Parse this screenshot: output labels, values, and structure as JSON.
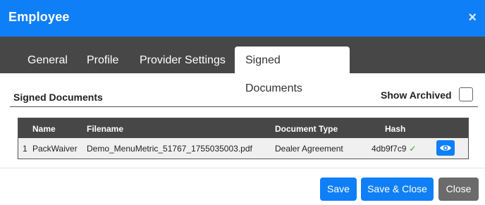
{
  "dialog": {
    "title": "Employee",
    "close_glyph": "×"
  },
  "tabs": [
    {
      "label": "General"
    },
    {
      "label": "Profile"
    },
    {
      "label": "Provider Settings"
    },
    {
      "label": "Signed Documents",
      "active": true
    }
  ],
  "section": {
    "title": "Signed Documents",
    "show_archived_label": "Show Archived",
    "show_archived_checked": false
  },
  "table": {
    "columns": [
      "Name",
      "Filename",
      "Document Type",
      "Hash"
    ],
    "rows": [
      {
        "index": "1",
        "name": "PackWaiver",
        "filename": "Demo_MenuMetric_51767_1755035003.pdf",
        "document_type": "Dealer Agreement",
        "hash": "4db9f7c9",
        "hash_verified_glyph": "✓",
        "action_icon": "eye-icon"
      }
    ]
  },
  "buttons": {
    "save": "Save",
    "save_close": "Save & Close",
    "close": "Close"
  },
  "colors": {
    "primary": "#0f7ff7",
    "tabbar": "#474747",
    "secondary": "#6b6b6b",
    "verified": "#2fa52f"
  }
}
